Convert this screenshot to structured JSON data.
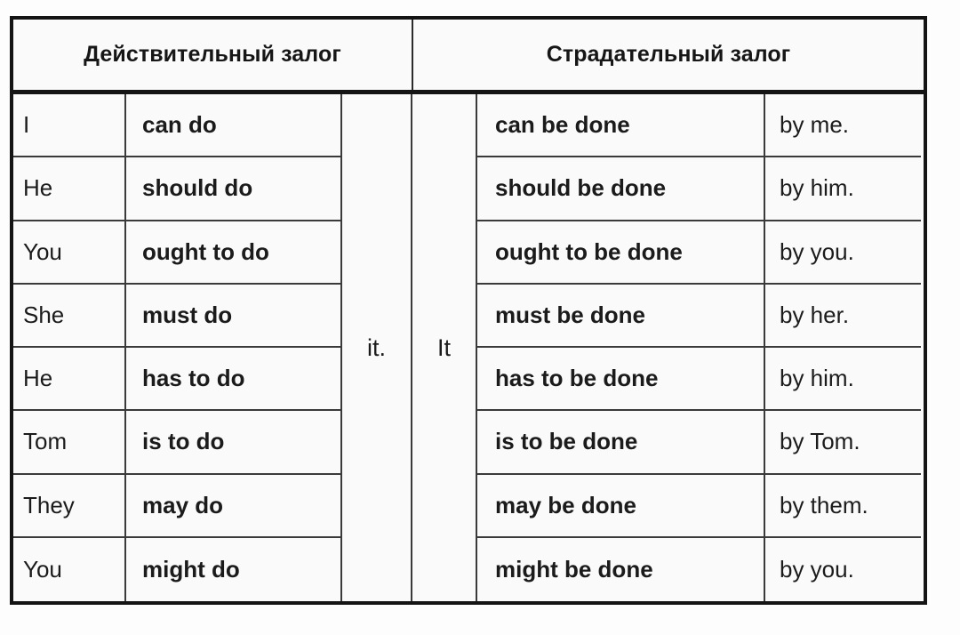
{
  "table": {
    "headers": {
      "active": "Действительный залог",
      "passive": "Страдательный залог"
    },
    "middle": {
      "active_object": "it.",
      "passive_subject": "It"
    },
    "rows": [
      {
        "pronoun": "I",
        "active_verb": "can do",
        "passive_verb": "can be done",
        "agent": "by me."
      },
      {
        "pronoun": "He",
        "active_verb": "should do",
        "passive_verb": "should be done",
        "agent": "by him."
      },
      {
        "pronoun": "You",
        "active_verb": "ought to do",
        "passive_verb": "ought to be done",
        "agent": "by you."
      },
      {
        "pronoun": "She",
        "active_verb": "must do",
        "passive_verb": "must be done",
        "agent": "by her."
      },
      {
        "pronoun": "He",
        "active_verb": "has to do",
        "passive_verb": "has to be done",
        "agent": "by him."
      },
      {
        "pronoun": "Tom",
        "active_verb": "is to do",
        "passive_verb": "is to be done",
        "agent": "by Tom."
      },
      {
        "pronoun": "They",
        "active_verb": "may do",
        "passive_verb": "may be done",
        "agent": "by them."
      },
      {
        "pronoun": "You",
        "active_verb": "might do",
        "passive_verb": "might be done",
        "agent": "by you."
      }
    ]
  },
  "colors": {
    "frame": "#141414",
    "grid_line": "#3a3a3a",
    "text": "#1b1b1b",
    "cell_background": "#fafafa"
  }
}
